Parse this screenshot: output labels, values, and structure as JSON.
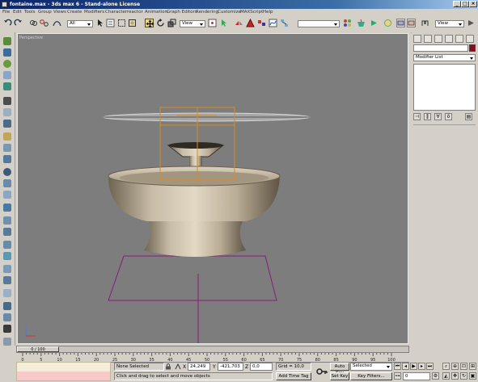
{
  "window": {
    "title": "fontaine.max - 3ds max 6 - Stand-alone License"
  },
  "menu": [
    "File",
    "Edit",
    "Tools",
    "Group",
    "Views",
    "Create",
    "Modifiers",
    "Character",
    "reactor",
    "Animation",
    "Graph Editors",
    "Rendering",
    "Customize",
    "MAXScript",
    "Help"
  ],
  "toolbar": {
    "selection_filter": "All",
    "ref_coord": "View",
    "named_sel": "",
    "right_coord": "View"
  },
  "viewport": {
    "label": "Perspective"
  },
  "command_panel": {
    "modifier_list": "Modifier List"
  },
  "timeline": {
    "frame_counter": "0 / 100",
    "ticks": [
      "0",
      "5",
      "10",
      "15",
      "20",
      "25",
      "30",
      "35",
      "40",
      "45",
      "50",
      "55",
      "60",
      "65",
      "70",
      "75",
      "80",
      "85",
      "90",
      "95",
      "100"
    ]
  },
  "status": {
    "selection": "None Selected",
    "x_label": "X",
    "x_value": "24,249",
    "y_label": "Y",
    "y_value": "-421,703",
    "z_label": "Z",
    "z_value": "0,0",
    "grid": "Grid = 10,0",
    "prompt": "Click and drag to select and move objects",
    "add_time_tag": "Add Time Tag",
    "auto_key": "Auto Key",
    "set_key": "Set Key",
    "key_mode": "Selected",
    "key_filters": "Key Filters...",
    "frame_value": "0"
  },
  "colors": {
    "accent": "#8b0a22",
    "selection_box": "#d98c1e",
    "grid": "#8a1a7a",
    "title_bar": "#0a246a"
  }
}
